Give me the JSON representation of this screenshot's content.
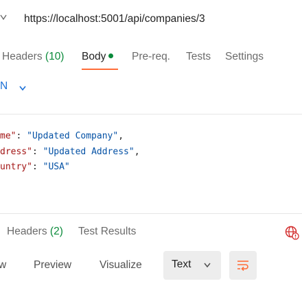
{
  "request": {
    "url": "https://localhost:5001/api/companies/3"
  },
  "request_tabs": [
    {
      "label": "Headers",
      "count": "(10)"
    },
    {
      "label": "Body"
    },
    {
      "label": "Pre-req."
    },
    {
      "label": "Tests"
    },
    {
      "label": "Settings"
    }
  ],
  "body_format": "N",
  "code_lines": [
    {
      "key": "me\"",
      "sep": ": ",
      "value": "\"Updated Company\"",
      "end": ","
    },
    {
      "key": "dress\"",
      "sep": ": ",
      "value": "\"Updated Address\"",
      "end": ","
    },
    {
      "key": "untry\"",
      "sep": ": ",
      "value": "\"USA\"",
      "end": ""
    }
  ],
  "response_tabs": [
    {
      "label": "Headers",
      "count": "(2)"
    },
    {
      "label": "Test Results"
    }
  ],
  "view_options": {
    "pretty": "w",
    "preview": "Preview",
    "visualize": "Visualize",
    "language": "Text"
  },
  "colors": {
    "accent": "#ff6c37",
    "status_green": "#0a8a3a",
    "link_blue": "#1a6fd6",
    "json_key": "#a31515",
    "json_string": "#0451a5",
    "alert_red": "#d32f2f"
  },
  "icons": {
    "url_method": "chevron-down-icon",
    "format": "chevron-down-icon",
    "network": "globe-alert-icon",
    "language": "chevron-down-icon",
    "wrap": "wrap-lines-icon"
  }
}
